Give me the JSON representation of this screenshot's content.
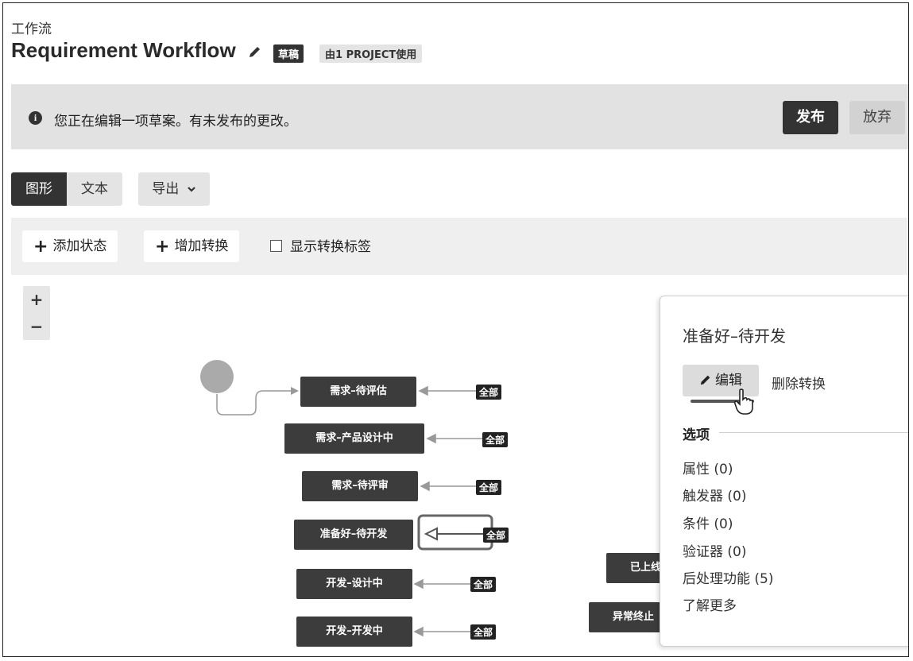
{
  "header": {
    "breadcrumb": "工作流",
    "title": "Requirement Workflow",
    "draft_badge": "草稿",
    "project_badge": "由1 PROJECT使用"
  },
  "banner": {
    "message": "您正在编辑一项草案。有未发布的更改。",
    "publish_label": "发布",
    "discard_label": "放弃"
  },
  "view_tabs": {
    "graph": "图形",
    "text": "文本",
    "export": "导出"
  },
  "toolbar": {
    "add_state": "添加状态",
    "add_transition": "增加转换",
    "show_labels": "显示转换标签"
  },
  "zoom": {
    "in": "+",
    "out": "−"
  },
  "diagram": {
    "states": [
      {
        "label": "需求–待评估",
        "tag": "全部"
      },
      {
        "label": "需求–产品设计中",
        "tag": "全部"
      },
      {
        "label": "需求–待评审",
        "tag": "全部"
      },
      {
        "label": "准备好–待开发",
        "tag": "全部"
      },
      {
        "label": "开发–设计中",
        "tag": "全部"
      },
      {
        "label": "开发–开发中",
        "tag": "全部"
      }
    ],
    "right_states": [
      "已上线",
      "异常终止"
    ]
  },
  "panel": {
    "title": "准备好–待开发",
    "edit_label": "编辑",
    "delete_label": "删除转换",
    "options_heading": "选项",
    "options": [
      "属性 (0)",
      "触发器 (0)",
      "条件 (0)",
      "验证器 (0)",
      "后处理功能 (5)",
      "了解更多"
    ]
  },
  "colors": {
    "dark": "#333333",
    "banner_bg": "#e2e2e2",
    "state_bg": "#3c3c3c"
  }
}
